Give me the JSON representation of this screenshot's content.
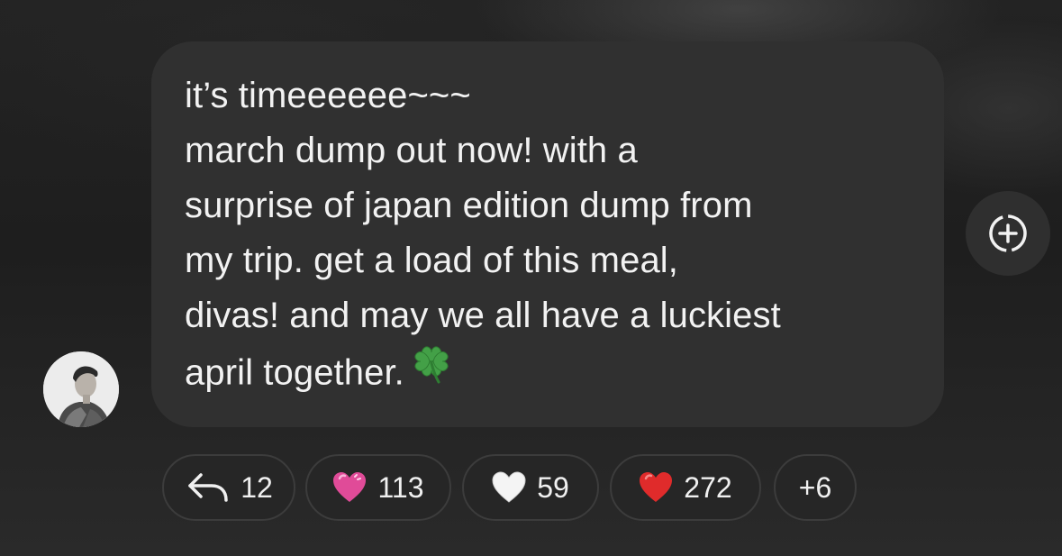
{
  "message": {
    "lines": [
      "it’s timeeeeee~~~",
      "march dump out now! with a",
      "surprise of japan edition dump from",
      "my trip. get a load of this meal,",
      "divas! and may we all have a luckiest",
      "april together."
    ],
    "trailing_emoji": "clover-icon"
  },
  "reactions": {
    "replies": "12",
    "pink_heart": "113",
    "white_heart": "59",
    "red_heart": "272",
    "more": "+6"
  },
  "colors": {
    "bubble": "#303030",
    "text": "#f2f2f2",
    "pill": "#262626",
    "pink_heart": "#e04b98",
    "red_heart": "#e02b2b",
    "clover": "#43a047"
  }
}
